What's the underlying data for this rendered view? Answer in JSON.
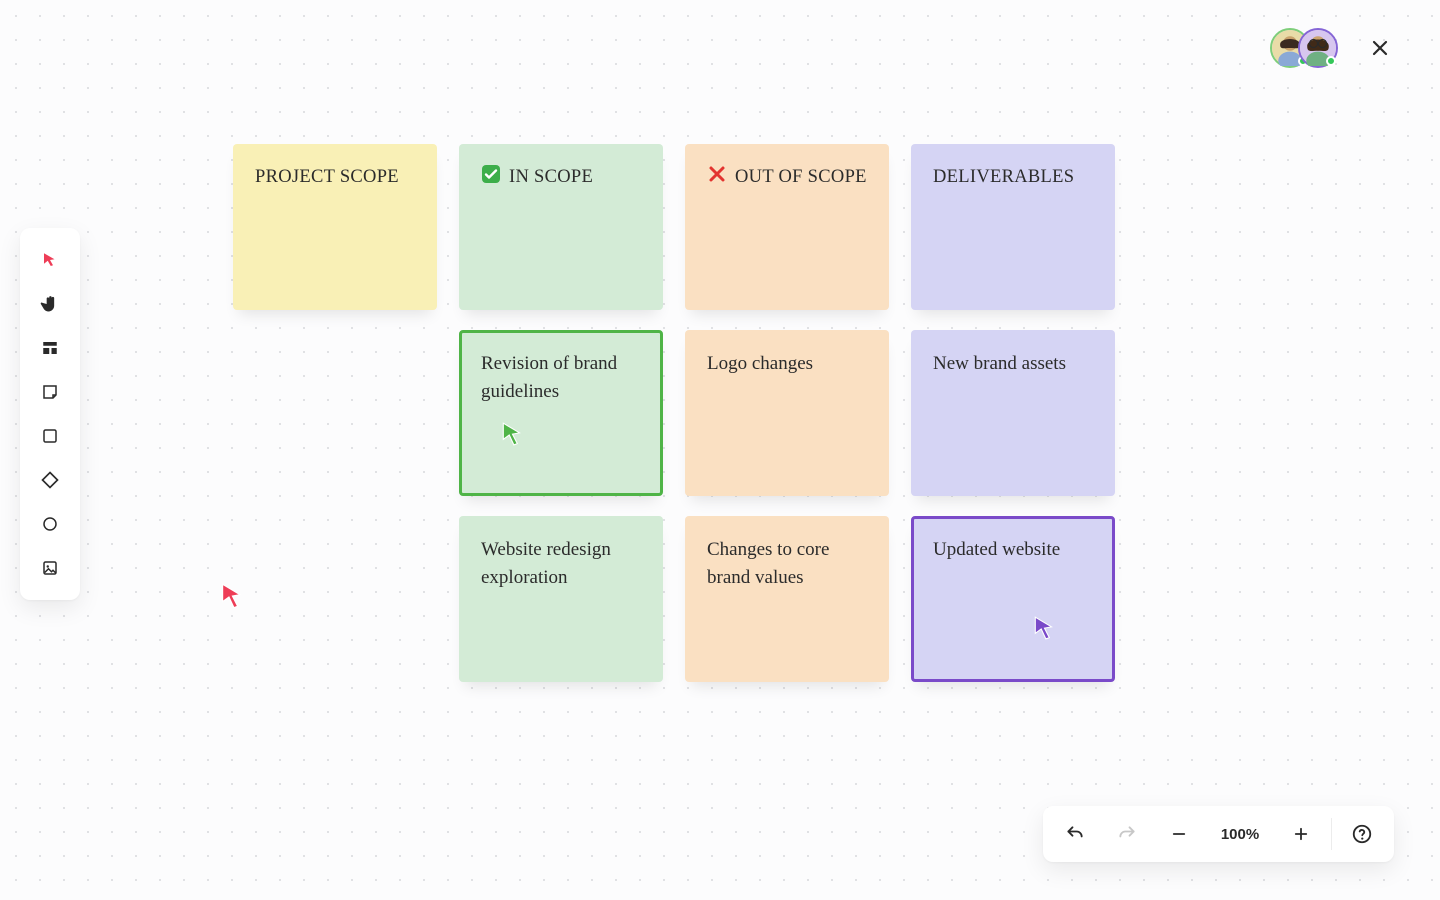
{
  "header": {
    "avatars": [
      {
        "name": "collaborator-1",
        "ring": "#7ece7a"
      },
      {
        "name": "collaborator-2",
        "ring": "#8565d6"
      }
    ]
  },
  "toolbar": {
    "tools": [
      {
        "id": "select",
        "active": true
      },
      {
        "id": "pan",
        "active": false
      },
      {
        "id": "template",
        "active": false
      },
      {
        "id": "sticky",
        "active": false
      },
      {
        "id": "rect",
        "active": false
      },
      {
        "id": "diamond",
        "active": false
      },
      {
        "id": "circle",
        "active": false
      },
      {
        "id": "image",
        "active": false
      }
    ]
  },
  "board": {
    "headers": {
      "project_scope": "Project Scope",
      "in_scope": "In Scope",
      "out_of_scope": "Out of Scope",
      "deliverables": "Deliverables"
    },
    "notes": {
      "in_scope_1": "Revision of brand guidelines",
      "in_scope_2": "Website redesign exploration",
      "out_scope_1": "Logo changes",
      "out_scope_2": "Changes to core brand values",
      "deliverable_1": "New brand assets",
      "deliverable_2": "Updated website"
    },
    "selection": {
      "green_selected_note": "in_scope_1",
      "purple_selected_note": "deliverable_2"
    },
    "collab_cursors": [
      {
        "on": "in_scope_1",
        "color": "#4fb447"
      },
      {
        "on": "deliverable_2",
        "color": "#7a4ac9"
      }
    ]
  },
  "canvas_cursor": {
    "color": "#ee3d57"
  },
  "controls": {
    "zoom_label": "100%"
  }
}
